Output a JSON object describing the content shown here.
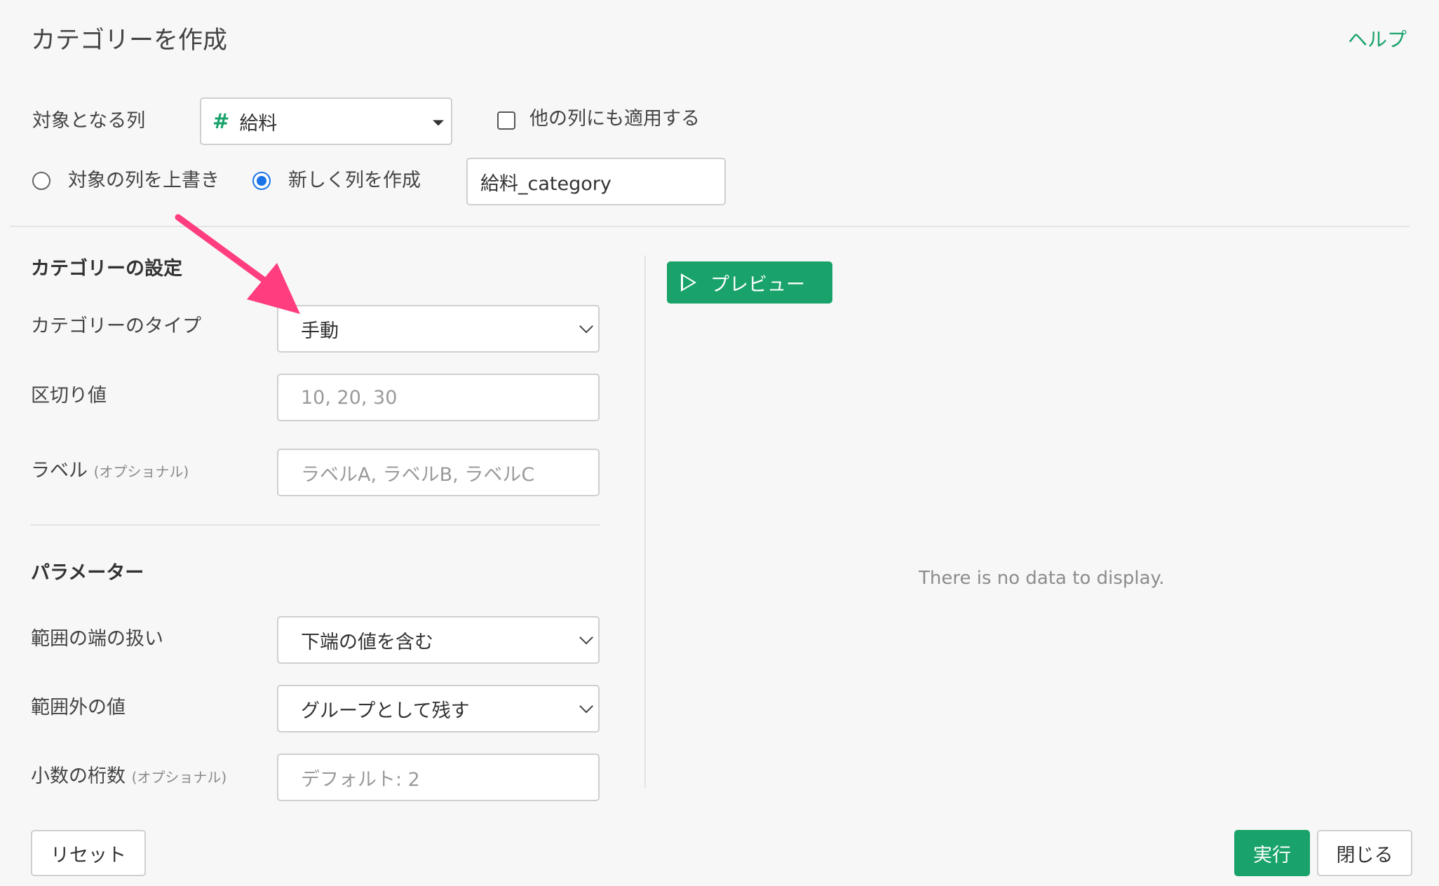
{
  "header": {
    "title": "カテゴリーを作成",
    "help_label": "ヘルプ"
  },
  "target": {
    "label": "対象となる列",
    "column_icon": "#",
    "column_value": "給料",
    "apply_other_label": "他の列にも適用する",
    "apply_other_checked": false
  },
  "output": {
    "overwrite_label": "対象の列を上書き",
    "new_column_label": "新しく列を作成",
    "selected": "new_column",
    "new_column_value": "給料_category"
  },
  "category_settings": {
    "heading": "カテゴリーの設定",
    "type_label": "カテゴリーのタイプ",
    "type_value": "手動",
    "breaks_label": "区切り値",
    "breaks_placeholder": "10, 20, 30",
    "labels_label": "ラベル",
    "labels_optional": "(オプショナル)",
    "labels_placeholder": "ラベルA, ラベルB, ラベルC"
  },
  "parameters": {
    "heading": "パラメーター",
    "range_edge_label": "範囲の端の扱い",
    "range_edge_value": "下端の値を含む",
    "out_of_range_label": "範囲外の値",
    "out_of_range_value": "グループとして残す",
    "decimals_label": "小数の桁数",
    "decimals_optional": "(オプショナル)",
    "decimals_placeholder": "デフォルト: 2"
  },
  "preview": {
    "button_label": "プレビュー",
    "empty_message": "There is no data to display."
  },
  "footer": {
    "reset_label": "リセット",
    "run_label": "実行",
    "close_label": "閉じる"
  },
  "colors": {
    "accent": "#19a36a",
    "radio": "#1a73e8",
    "annotation_arrow": "#ff3d7f"
  }
}
